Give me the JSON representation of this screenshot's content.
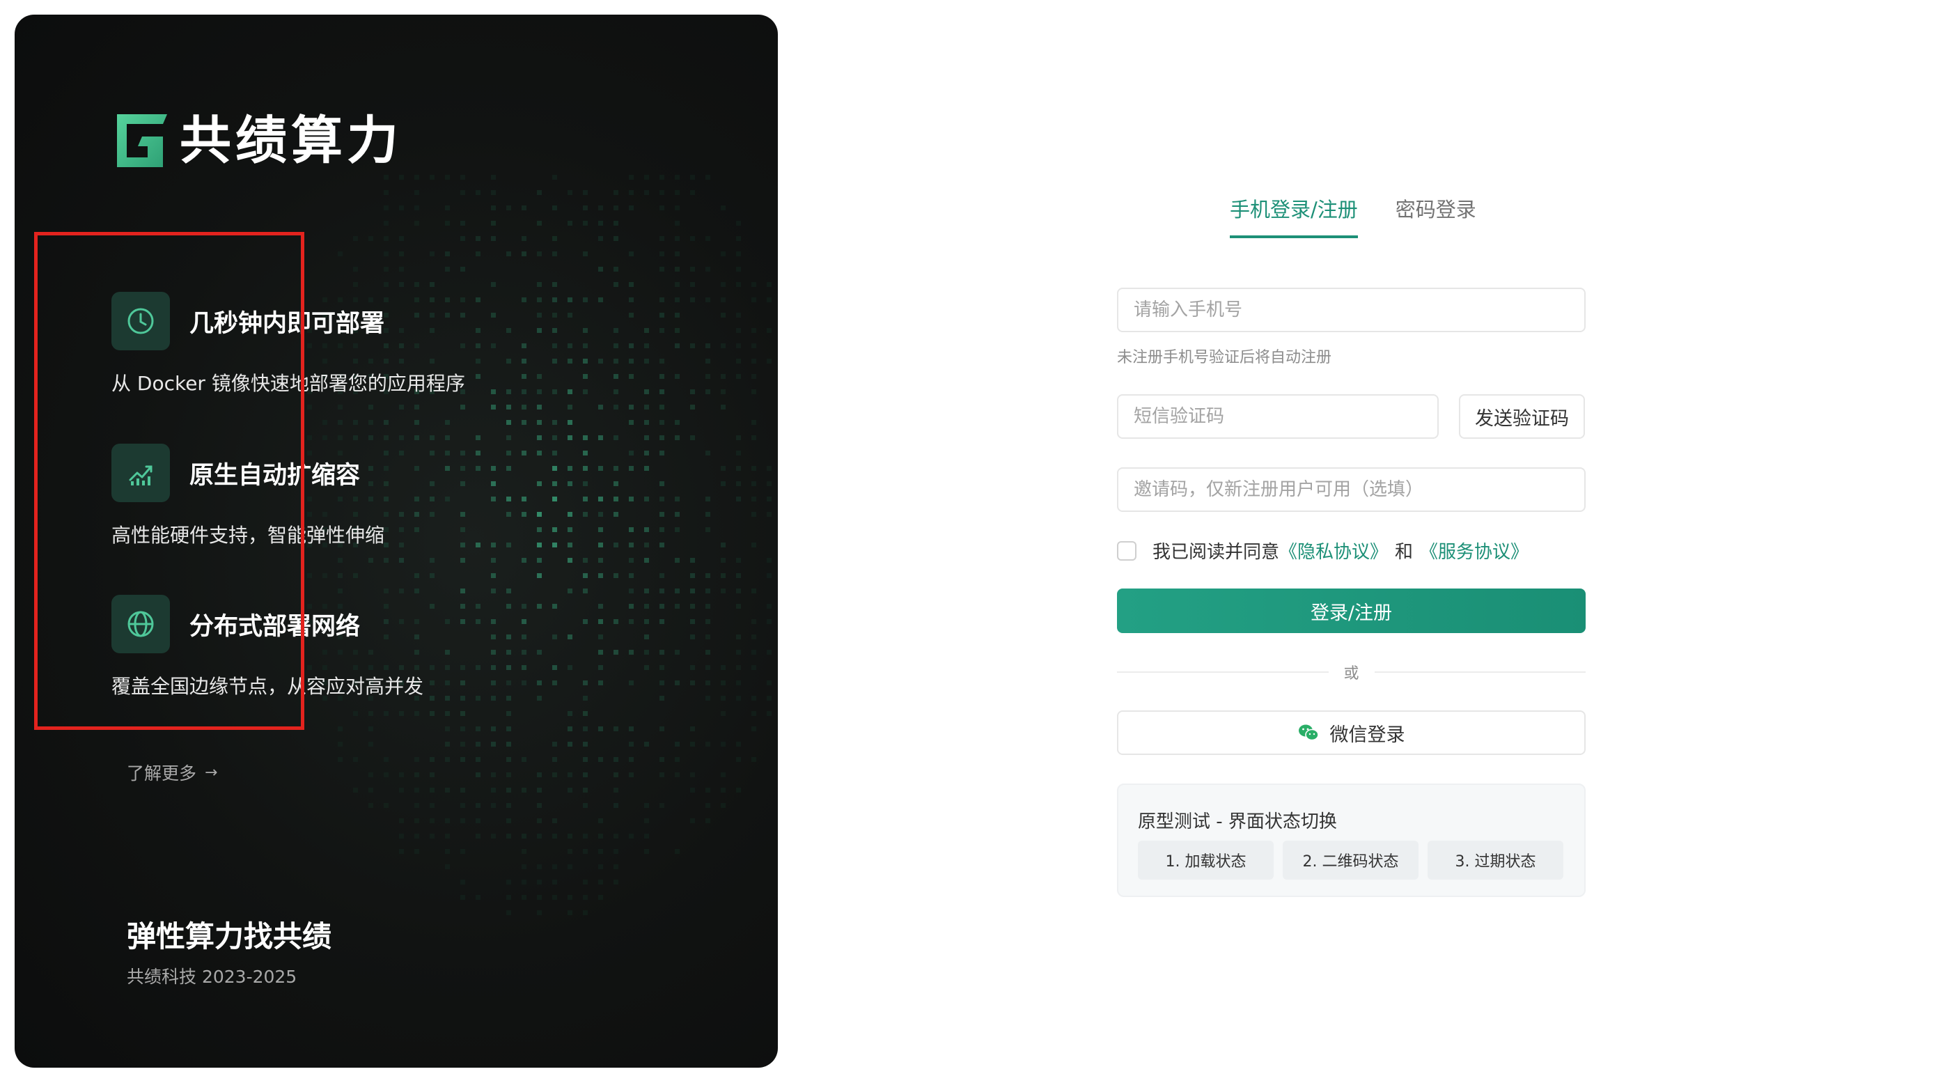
{
  "brand": {
    "name": "共绩算力",
    "logo_icon": "brand-g-logo-icon",
    "accent_color": "#1d9077",
    "logo_green": "#46c08f"
  },
  "features": [
    {
      "icon": "clock-icon",
      "title": "几秒钟内即可部署",
      "description": "从 Docker 镜像快速地部署您的应用程序"
    },
    {
      "icon": "chart-growth-icon",
      "title": "原生自动扩缩容",
      "description": "高性能硬件支持，智能弹性伸缩"
    },
    {
      "icon": "globe-icon",
      "title": "分布式部署网络",
      "description": "覆盖全国边缘节点，从容应对高并发"
    }
  ],
  "learn_more": {
    "label": "了解更多",
    "icon": "arrow-right-icon"
  },
  "footer": {
    "slogan": "弹性算力找共绩",
    "copyright": "共绩科技 2023-2025"
  },
  "login": {
    "tabs": [
      {
        "label": "手机登录/注册",
        "active": true
      },
      {
        "label": "密码登录",
        "active": false
      }
    ],
    "phone": {
      "placeholder": "请输入手机号",
      "value": ""
    },
    "phone_hint": "未注册手机号验证后将自动注册",
    "sms_code": {
      "placeholder": "短信验证码",
      "value": ""
    },
    "send_code_label": "发送验证码",
    "invite_code": {
      "placeholder": "邀请码，仅新注册用户可用（选填）",
      "value": ""
    },
    "agreement": {
      "checked": false,
      "prefix": "我已阅读并同意",
      "privacy_link": "《隐私协议》",
      "and": "和",
      "service_link": "《服务协议》"
    },
    "submit_label": "登录/注册",
    "divider_label": "或",
    "wechat": {
      "label": "微信登录",
      "icon": "wechat-icon",
      "icon_color": "#2aae67"
    }
  },
  "prototype_panel": {
    "title": "原型测试 - 界面状态切换",
    "buttons": [
      "1. 加载状态",
      "2. 二维码状态",
      "3. 过期状态"
    ]
  },
  "highlight": {
    "color": "#e3231e"
  }
}
